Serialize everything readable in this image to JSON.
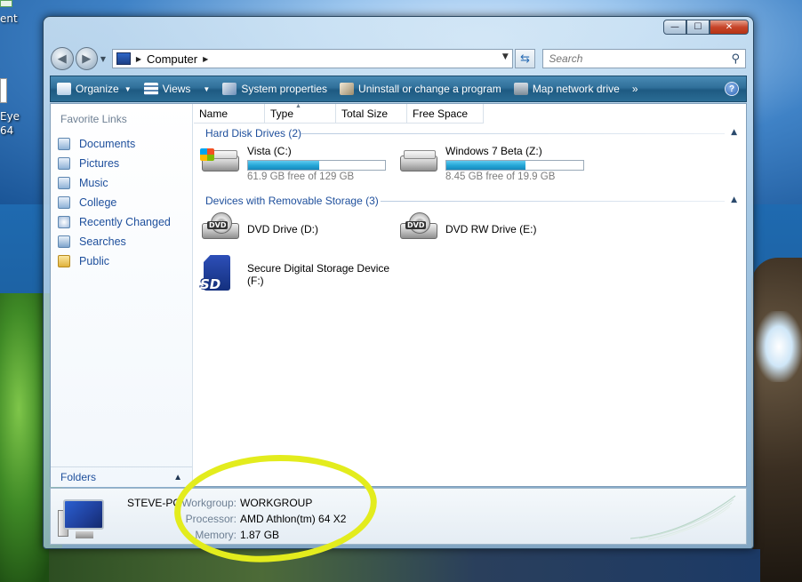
{
  "desktop": {
    "top_left_text": "ent",
    "left_text_1": "Eye",
    "left_text_2": "64"
  },
  "window": {
    "controls": {
      "minimize": "—",
      "maximize": "☐",
      "close": "✕"
    }
  },
  "navigation": {
    "back_icon": "back-arrow-icon",
    "forward_icon": "forward-arrow-icon",
    "address": "Computer",
    "search_placeholder": "Search"
  },
  "toolbar": {
    "organize": "Organize",
    "views": "Views",
    "system_properties": "System properties",
    "uninstall": "Uninstall or change a program",
    "map_drive": "Map network drive",
    "more": "»",
    "help": "?"
  },
  "sidebar": {
    "title": "Favorite Links",
    "items": [
      {
        "label": "Documents",
        "icon": "documents-icon"
      },
      {
        "label": "Pictures",
        "icon": "pictures-icon"
      },
      {
        "label": "Music",
        "icon": "music-icon"
      },
      {
        "label": "College",
        "icon": "college-folder-icon"
      },
      {
        "label": "Recently Changed",
        "icon": "recently-changed-icon"
      },
      {
        "label": "Searches",
        "icon": "searches-icon"
      },
      {
        "label": "Public",
        "icon": "public-folder-icon"
      }
    ],
    "folders_label": "Folders"
  },
  "columns": [
    "Name",
    "Type",
    "Total Size",
    "Free Space"
  ],
  "groups": {
    "hard_disks": {
      "header": "Hard Disk Drives (2)",
      "drives": [
        {
          "name": "Vista (C:)",
          "free": "61.9 GB free of 129 GB",
          "used_fraction": 0.52
        },
        {
          "name": "Windows 7 Beta (Z:)",
          "free": "8.45 GB free of 19.9 GB",
          "used_fraction": 0.58
        }
      ]
    },
    "removable": {
      "header": "Devices with Removable Storage (3)",
      "devices": [
        {
          "name": "DVD Drive (D:)",
          "tag": "DVD"
        },
        {
          "name": "DVD RW Drive (E:)",
          "tag": "DVD"
        },
        {
          "name_line1": "Secure Digital Storage Device",
          "name_line2": "(F:)",
          "tag": "SD"
        }
      ]
    }
  },
  "details": {
    "computer_name": "STEVE-PC",
    "properties": [
      {
        "label": "Workgroup:",
        "value": "WORKGROUP"
      },
      {
        "label": "Processor:",
        "value": "AMD Athlon(tm) 64 X2"
      },
      {
        "label": "Memory:",
        "value": "1.87 GB"
      }
    ]
  },
  "colors": {
    "link": "#1e4f9c",
    "toolbar": "#2f6f99",
    "drive_fill": "#26a7d8",
    "highlight": "#e3ec1d"
  }
}
